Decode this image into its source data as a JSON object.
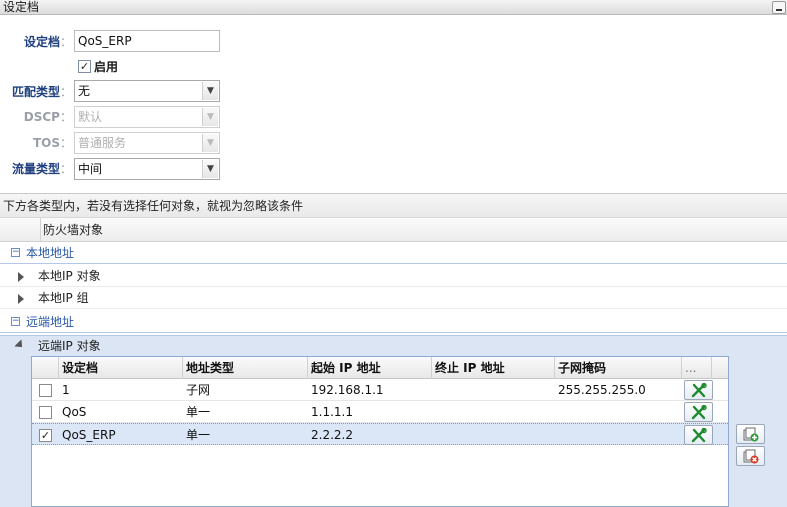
{
  "window": {
    "title": "设定档"
  },
  "form": {
    "profile_label": "设定档",
    "profile_value": "QoS_ERP",
    "enable_label": "启用",
    "enable_checked": true,
    "match_type_label": "匹配类型",
    "match_type_value": "无",
    "dscp_label": "DSCP",
    "dscp_value": "默认",
    "tos_label": "TOS",
    "tos_value": "普通服务",
    "traffic_type_label": "流量类型",
    "traffic_type_value": "中间"
  },
  "hint": "下方各类型内，若没有选择任何对象，就视为忽略该条件",
  "firewall_header": "防火墙对象",
  "groups": {
    "local": {
      "title": "本地地址",
      "items": [
        "本地IP 对象",
        "本地IP 组"
      ]
    },
    "remote": {
      "title": "远端地址",
      "expanded_item": "远端IP 对象"
    }
  },
  "grid": {
    "columns": [
      "设定档",
      "地址类型",
      "起始 IP 地址",
      "终止 IP 地址",
      "子网掩码",
      "..."
    ],
    "rows": [
      {
        "checked": false,
        "profile": "1",
        "type": "子网",
        "start": "192.168.1.1",
        "end": "",
        "mask": "255.255.255.0"
      },
      {
        "checked": false,
        "profile": "QoS",
        "type": "单一",
        "start": "1.1.1.1",
        "end": "",
        "mask": ""
      },
      {
        "checked": true,
        "profile": "QoS_ERP",
        "type": "单一",
        "start": "2.2.2.2",
        "end": "",
        "mask": ""
      }
    ]
  },
  "colors": {
    "accent": "#2a58a8",
    "label": "#1f3f7f",
    "selection": "#dbe6f7",
    "expanded_bg": "#dbe5f4"
  },
  "icons": [
    "tools-icon",
    "add-object-icon",
    "delete-object-icon",
    "minimize-icon"
  ]
}
